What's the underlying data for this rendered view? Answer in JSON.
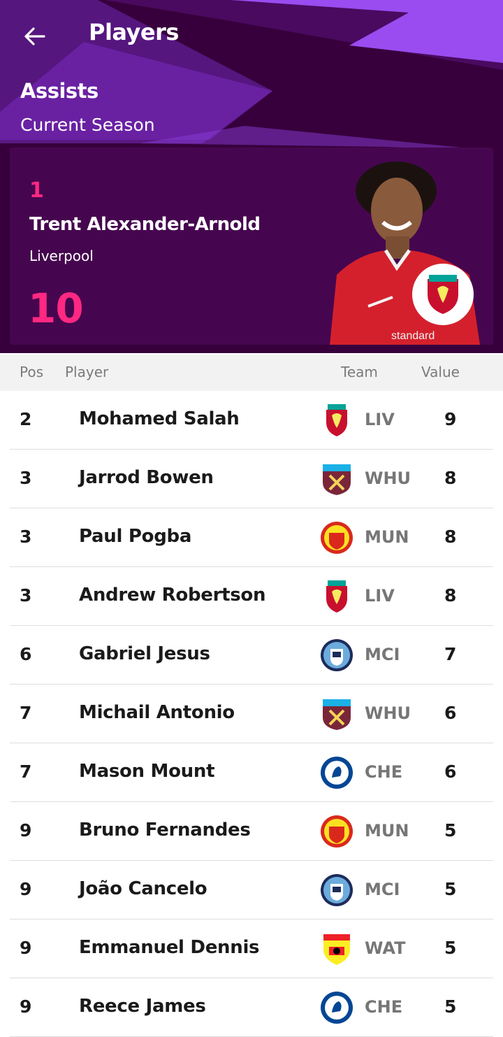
{
  "header": {
    "title": "Players",
    "back_icon": "arrow-left-icon"
  },
  "stat": {
    "title": "Assists",
    "subtitle": "Current Season"
  },
  "leader": {
    "rank": "1",
    "name": "Trent Alexander-Arnold",
    "team": "Liverpool",
    "value": "10",
    "crest": "LIV"
  },
  "table": {
    "columns": {
      "pos": "Pos",
      "player": "Player",
      "team": "Team",
      "value": "Value"
    },
    "rows": [
      {
        "pos": "2",
        "name": "Mohamed Salah",
        "team": "LIV",
        "value": "9"
      },
      {
        "pos": "3",
        "name": "Jarrod Bowen",
        "team": "WHU",
        "value": "8"
      },
      {
        "pos": "3",
        "name": "Paul Pogba",
        "team": "MUN",
        "value": "8"
      },
      {
        "pos": "3",
        "name": "Andrew Robertson",
        "team": "LIV",
        "value": "8"
      },
      {
        "pos": "6",
        "name": "Gabriel Jesus",
        "team": "MCI",
        "value": "7"
      },
      {
        "pos": "7",
        "name": "Michail Antonio",
        "team": "WHU",
        "value": "6"
      },
      {
        "pos": "7",
        "name": "Mason Mount",
        "team": "CHE",
        "value": "6"
      },
      {
        "pos": "9",
        "name": "Bruno Fernandes",
        "team": "MUN",
        "value": "5"
      },
      {
        "pos": "9",
        "name": "João Cancelo",
        "team": "MCI",
        "value": "5"
      },
      {
        "pos": "9",
        "name": "Emmanuel Dennis",
        "team": "WAT",
        "value": "5"
      },
      {
        "pos": "9",
        "name": "Reece James",
        "team": "CHE",
        "value": "5"
      }
    ]
  },
  "colors": {
    "brand_purple": "#37003c",
    "accent_pink": "#ff2882",
    "accent_violet": "#963cff"
  }
}
